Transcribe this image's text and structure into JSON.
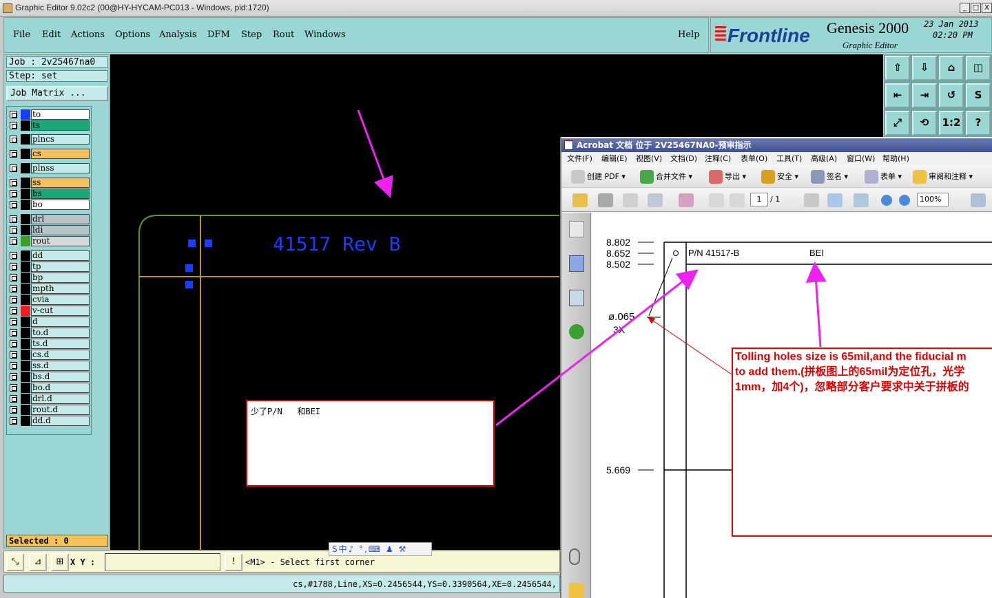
{
  "window": {
    "title": "Graphic Editor 9.02c2 (00@HY-HYCAM-PC013 - Windows, pid:1720)",
    "controls": [
      "_",
      "□",
      "X"
    ]
  },
  "menu": [
    "File",
    "Edit",
    "Actions",
    "Options",
    "Analysis",
    "DFM",
    "Step",
    "Rout",
    "Windows"
  ],
  "help_label": "Help",
  "brand": {
    "logo": "Frontline",
    "product": "Genesis 2000",
    "subtitle": "Graphic Editor",
    "date": "23 Jan 2013",
    "time": "02:20 PM"
  },
  "job": {
    "job_line": "Job : 2v25467na0",
    "step_line": "Step: set",
    "matrix_button": "Job Matrix ..."
  },
  "layers": [
    {
      "name": "to",
      "color": "#ffffff",
      "swatch": "#1a3cff"
    },
    {
      "name": "ts",
      "color": "#19a878",
      "swatch": "#000000"
    },
    {
      "name": "plncs",
      "color": "#c4ebe9",
      "swatch": "#000000"
    },
    {
      "name": "cs",
      "color": "#f5c15a",
      "swatch": "#000000"
    },
    {
      "name": "plnss",
      "color": "#c4ebe9",
      "swatch": "#000000"
    },
    {
      "name": "ss",
      "color": "#f5c15a",
      "swatch": "#000000"
    },
    {
      "name": "bs",
      "color": "#19a878",
      "swatch": "#000000"
    },
    {
      "name": "bo",
      "color": "#ffffff",
      "swatch": "#000000"
    },
    {
      "name": "drl",
      "color": "#b8c4c8",
      "swatch": "#000000"
    },
    {
      "name": "ldi",
      "color": "#b8c4c8",
      "swatch": "#000000"
    },
    {
      "name": "rout",
      "color": "#d8d8d8",
      "swatch": "#3aa020"
    },
    {
      "name": "dd",
      "color": "#c4ebe9",
      "swatch": "#000000"
    },
    {
      "name": "tp",
      "color": "#c4ebe9",
      "swatch": "#000000"
    },
    {
      "name": "bp",
      "color": "#c4ebe9",
      "swatch": "#000000"
    },
    {
      "name": "mpth",
      "color": "#c4ebe9",
      "swatch": "#000000"
    },
    {
      "name": "cvia",
      "color": "#c4ebe9",
      "swatch": "#000000"
    },
    {
      "name": "v-cut",
      "color": "#c4ebe9",
      "swatch": "#e82020"
    },
    {
      "name": "d",
      "color": "#c4ebe9",
      "swatch": "#000000"
    },
    {
      "name": "to.d",
      "color": "#c4ebe9",
      "swatch": "#000000"
    },
    {
      "name": "ts.d",
      "color": "#c4ebe9",
      "swatch": "#000000"
    },
    {
      "name": "cs.d",
      "color": "#c4ebe9",
      "swatch": "#000000"
    },
    {
      "name": "ss.d",
      "color": "#c4ebe9",
      "swatch": "#000000"
    },
    {
      "name": "bs.d",
      "color": "#c4ebe9",
      "swatch": "#000000"
    },
    {
      "name": "bo.d",
      "color": "#c4ebe9",
      "swatch": "#000000"
    },
    {
      "name": "drl.d",
      "color": "#c4ebe9",
      "swatch": "#000000"
    },
    {
      "name": "rout.d",
      "color": "#c4ebe9",
      "swatch": "#000000"
    },
    {
      "name": "dd.d",
      "color": "#c4ebe9",
      "swatch": "#000000"
    }
  ],
  "selected": "Selected : 0",
  "canvas": {
    "board_text": "41517 Rev B",
    "annotation": "少了P/N   和BEI"
  },
  "toolbox": [
    "⇧",
    "⇩",
    "⌂",
    "◫",
    "⇤",
    "⇥",
    "↺",
    "S",
    "⤢",
    "⟲",
    "1:2",
    "?"
  ],
  "command": {
    "xy_label": "X Y :",
    "xy_value": "",
    "prompt": "<M1> - Select first corner",
    "status": "cs,#1788,Line,XS=0.2456544,YS=0.3390564,XE=0.2456544,"
  },
  "acrobat": {
    "title": "Acrobat 文档 位于 2V25467NA0-预审指示",
    "menu": [
      "文件(F)",
      "编辑(E)",
      "视图(V)",
      "文档(D)",
      "注释(C)",
      "表单(O)",
      "工具(T)",
      "高级(A)",
      "窗口(W)",
      "帮助(H)"
    ],
    "toolbar": [
      "创建 PDF ▾",
      "合并文件 ▾",
      "导出 ▾",
      "安全 ▾",
      "签名 ▾",
      "表单 ▾",
      "审阅和注释 ▾"
    ],
    "page_value": "1",
    "page_total": "/ 1",
    "zoom": "100%",
    "dims": [
      "8.802",
      "8.652",
      "8.502",
      "5.669"
    ],
    "pn_label": "P/N  41517-B",
    "bei_label": "BEI",
    "hole_dim": "ø.065",
    "hole_count": "3X",
    "note_lines": [
      "Tolling holes size is 65mil,and the fiducial m",
      "to add them.(拼板图上的65mil为定位孔，光学",
      "1mm，加4个)，忽略部分客户要求中关于拼板的"
    ],
    "ime": "S中♪ °,⌨ ♟ ⚒"
  }
}
